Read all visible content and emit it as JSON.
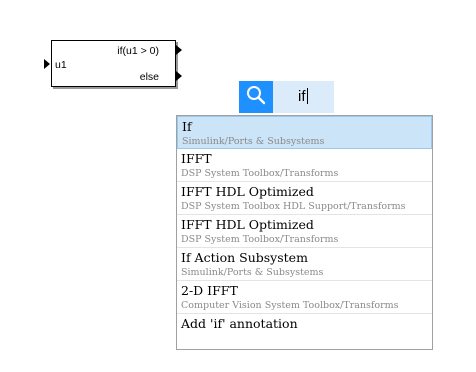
{
  "block": {
    "input_label": "u1",
    "output_if": "if(u1 > 0)",
    "output_else": "else"
  },
  "search": {
    "value": "if"
  },
  "results": [
    {
      "name": "If",
      "path": "Simulink/Ports & Subsystems",
      "selected": true
    },
    {
      "name": "IFFT",
      "path": "DSP System Toolbox/Transforms"
    },
    {
      "name": "IFFT HDL Optimized",
      "path": "DSP System Toolbox HDL Support/Transforms"
    },
    {
      "name": "IFFT HDL Optimized",
      "path": "DSP System Toolbox/Transforms"
    },
    {
      "name": "If Action Subsystem",
      "path": "Simulink/Ports & Subsystems"
    },
    {
      "name": "2-D IFFT",
      "path": "Computer Vision System Toolbox/Transforms"
    }
  ],
  "annotation": "Add 'if' annotation",
  "colors": {
    "search_button": "#1e90ff",
    "search_field": "#dcebfa",
    "selected_row": "#cce4f7"
  },
  "icons": {
    "search": "search-icon"
  }
}
